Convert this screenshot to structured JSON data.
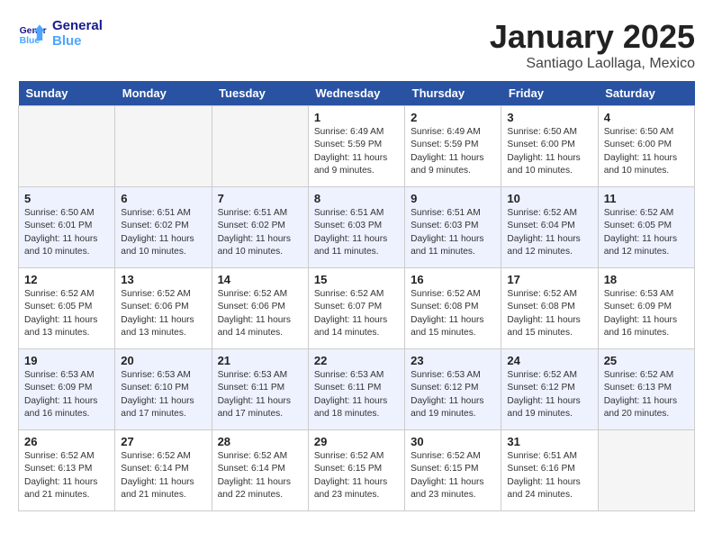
{
  "logo": {
    "line1": "General",
    "line2": "Blue"
  },
  "title": "January 2025",
  "subtitle": "Santiago Laollaga, Mexico",
  "days": [
    "Sunday",
    "Monday",
    "Tuesday",
    "Wednesday",
    "Thursday",
    "Friday",
    "Saturday"
  ],
  "weeks": [
    [
      {
        "day": "",
        "info": ""
      },
      {
        "day": "",
        "info": ""
      },
      {
        "day": "",
        "info": ""
      },
      {
        "day": "1",
        "info": "Sunrise: 6:49 AM\nSunset: 5:59 PM\nDaylight: 11 hours and 9 minutes."
      },
      {
        "day": "2",
        "info": "Sunrise: 6:49 AM\nSunset: 5:59 PM\nDaylight: 11 hours and 9 minutes."
      },
      {
        "day": "3",
        "info": "Sunrise: 6:50 AM\nSunset: 6:00 PM\nDaylight: 11 hours and 10 minutes."
      },
      {
        "day": "4",
        "info": "Sunrise: 6:50 AM\nSunset: 6:00 PM\nDaylight: 11 hours and 10 minutes."
      }
    ],
    [
      {
        "day": "5",
        "info": "Sunrise: 6:50 AM\nSunset: 6:01 PM\nDaylight: 11 hours and 10 minutes."
      },
      {
        "day": "6",
        "info": "Sunrise: 6:51 AM\nSunset: 6:02 PM\nDaylight: 11 hours and 10 minutes."
      },
      {
        "day": "7",
        "info": "Sunrise: 6:51 AM\nSunset: 6:02 PM\nDaylight: 11 hours and 10 minutes."
      },
      {
        "day": "8",
        "info": "Sunrise: 6:51 AM\nSunset: 6:03 PM\nDaylight: 11 hours and 11 minutes."
      },
      {
        "day": "9",
        "info": "Sunrise: 6:51 AM\nSunset: 6:03 PM\nDaylight: 11 hours and 11 minutes."
      },
      {
        "day": "10",
        "info": "Sunrise: 6:52 AM\nSunset: 6:04 PM\nDaylight: 11 hours and 12 minutes."
      },
      {
        "day": "11",
        "info": "Sunrise: 6:52 AM\nSunset: 6:05 PM\nDaylight: 11 hours and 12 minutes."
      }
    ],
    [
      {
        "day": "12",
        "info": "Sunrise: 6:52 AM\nSunset: 6:05 PM\nDaylight: 11 hours and 13 minutes."
      },
      {
        "day": "13",
        "info": "Sunrise: 6:52 AM\nSunset: 6:06 PM\nDaylight: 11 hours and 13 minutes."
      },
      {
        "day": "14",
        "info": "Sunrise: 6:52 AM\nSunset: 6:06 PM\nDaylight: 11 hours and 14 minutes."
      },
      {
        "day": "15",
        "info": "Sunrise: 6:52 AM\nSunset: 6:07 PM\nDaylight: 11 hours and 14 minutes."
      },
      {
        "day": "16",
        "info": "Sunrise: 6:52 AM\nSunset: 6:08 PM\nDaylight: 11 hours and 15 minutes."
      },
      {
        "day": "17",
        "info": "Sunrise: 6:52 AM\nSunset: 6:08 PM\nDaylight: 11 hours and 15 minutes."
      },
      {
        "day": "18",
        "info": "Sunrise: 6:53 AM\nSunset: 6:09 PM\nDaylight: 11 hours and 16 minutes."
      }
    ],
    [
      {
        "day": "19",
        "info": "Sunrise: 6:53 AM\nSunset: 6:09 PM\nDaylight: 11 hours and 16 minutes."
      },
      {
        "day": "20",
        "info": "Sunrise: 6:53 AM\nSunset: 6:10 PM\nDaylight: 11 hours and 17 minutes."
      },
      {
        "day": "21",
        "info": "Sunrise: 6:53 AM\nSunset: 6:11 PM\nDaylight: 11 hours and 17 minutes."
      },
      {
        "day": "22",
        "info": "Sunrise: 6:53 AM\nSunset: 6:11 PM\nDaylight: 11 hours and 18 minutes."
      },
      {
        "day": "23",
        "info": "Sunrise: 6:53 AM\nSunset: 6:12 PM\nDaylight: 11 hours and 19 minutes."
      },
      {
        "day": "24",
        "info": "Sunrise: 6:52 AM\nSunset: 6:12 PM\nDaylight: 11 hours and 19 minutes."
      },
      {
        "day": "25",
        "info": "Sunrise: 6:52 AM\nSunset: 6:13 PM\nDaylight: 11 hours and 20 minutes."
      }
    ],
    [
      {
        "day": "26",
        "info": "Sunrise: 6:52 AM\nSunset: 6:13 PM\nDaylight: 11 hours and 21 minutes."
      },
      {
        "day": "27",
        "info": "Sunrise: 6:52 AM\nSunset: 6:14 PM\nDaylight: 11 hours and 21 minutes."
      },
      {
        "day": "28",
        "info": "Sunrise: 6:52 AM\nSunset: 6:14 PM\nDaylight: 11 hours and 22 minutes."
      },
      {
        "day": "29",
        "info": "Sunrise: 6:52 AM\nSunset: 6:15 PM\nDaylight: 11 hours and 23 minutes."
      },
      {
        "day": "30",
        "info": "Sunrise: 6:52 AM\nSunset: 6:15 PM\nDaylight: 11 hours and 23 minutes."
      },
      {
        "day": "31",
        "info": "Sunrise: 6:51 AM\nSunset: 6:16 PM\nDaylight: 11 hours and 24 minutes."
      },
      {
        "day": "",
        "info": ""
      }
    ]
  ]
}
